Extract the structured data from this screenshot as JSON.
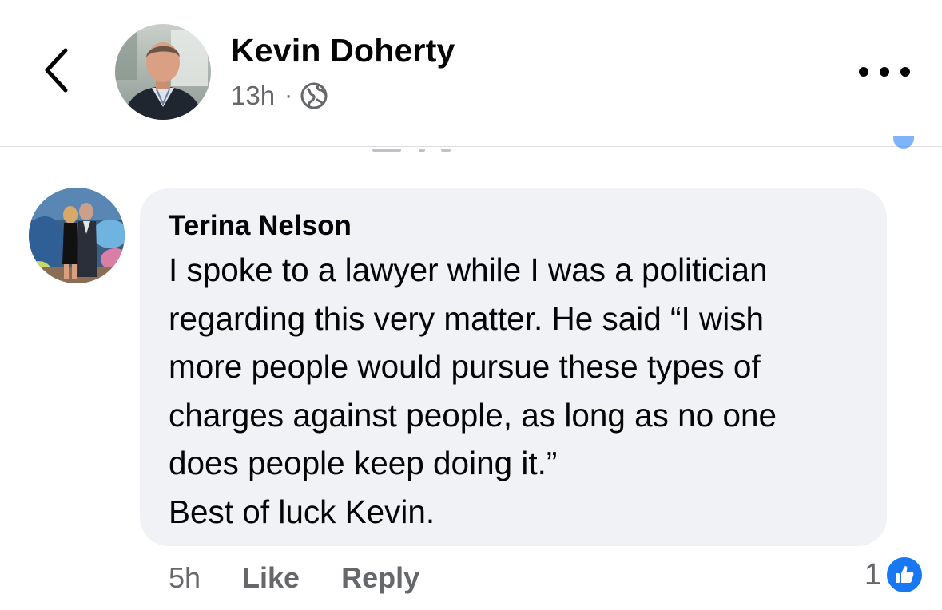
{
  "header": {
    "poster_name": "Kevin Doherty",
    "post_time": "13h",
    "separator": "·",
    "audience_icon": "globe-icon",
    "back_icon": "chevron-left-icon",
    "more_icon": "more-horizontal-icon"
  },
  "comment": {
    "author": "Terina Nelson",
    "lines": [
      "I spoke to a lawyer while I was a politician",
      "regarding this very matter. He said “I wish",
      "more people would pursue these types of",
      "charges against people, as long as no one",
      "does people keep doing it.”",
      "Best of luck Kevin."
    ],
    "time": "5h",
    "like_label": "Like",
    "reply_label": "Reply",
    "reaction_count": "1",
    "reaction_icon": "thumbs-up-icon"
  },
  "colors": {
    "accent": "#1877f2",
    "bubble": "#f0f2f5",
    "secondary_text": "#65676b",
    "primary_text": "#050505"
  }
}
